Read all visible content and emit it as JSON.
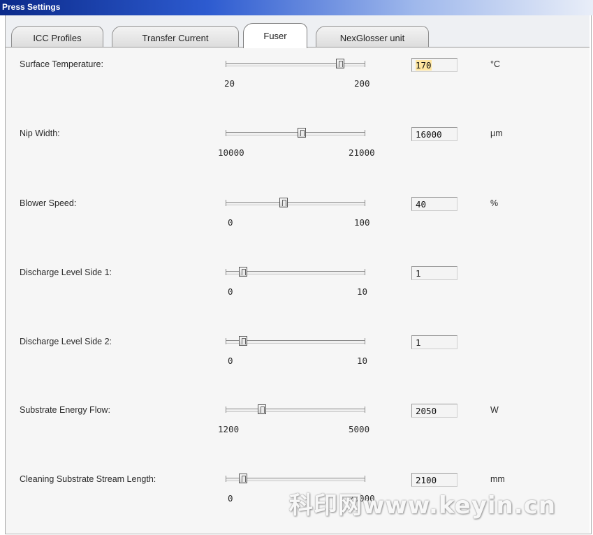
{
  "window": {
    "title": "Press Settings"
  },
  "tabs": [
    {
      "label": "ICC Profiles",
      "active": false
    },
    {
      "label": "Transfer Current",
      "active": false
    },
    {
      "label": "Fuser",
      "active": true
    },
    {
      "label": "NexGlosser unit",
      "active": false
    }
  ],
  "settings": [
    {
      "label": "Surface Temperature:",
      "min": "20",
      "max": "200",
      "value": "170",
      "unit": "°C",
      "slider_fraction": 0.83
    },
    {
      "label": "Nip Width:",
      "min": "10000",
      "max": "21000",
      "value": "16000",
      "unit": "µm",
      "slider_fraction": 0.55
    },
    {
      "label": "Blower Speed:",
      "min": "0",
      "max": "100",
      "value": "40",
      "unit": "%",
      "slider_fraction": 0.42
    },
    {
      "label": "Discharge Level Side 1:",
      "min": "0",
      "max": "10",
      "value": "1",
      "unit": "",
      "slider_fraction": 0.12
    },
    {
      "label": "Discharge Level Side 2:",
      "min": "0",
      "max": "10",
      "value": "1",
      "unit": "",
      "slider_fraction": 0.12
    },
    {
      "label": "Substrate Energy Flow:",
      "min": "1200",
      "max": "5000",
      "value": "2050",
      "unit": "W",
      "slider_fraction": 0.26
    },
    {
      "label": "Cleaning Substrate Stream Length:",
      "min": "0",
      "max": "20000",
      "value": "2100",
      "unit": "mm",
      "slider_fraction": 0.12
    }
  ],
  "watermark": "科印网www.keyin.cn",
  "colors": {
    "title_bar": "#0b2a8a",
    "highlight": "#ffe6a0"
  }
}
